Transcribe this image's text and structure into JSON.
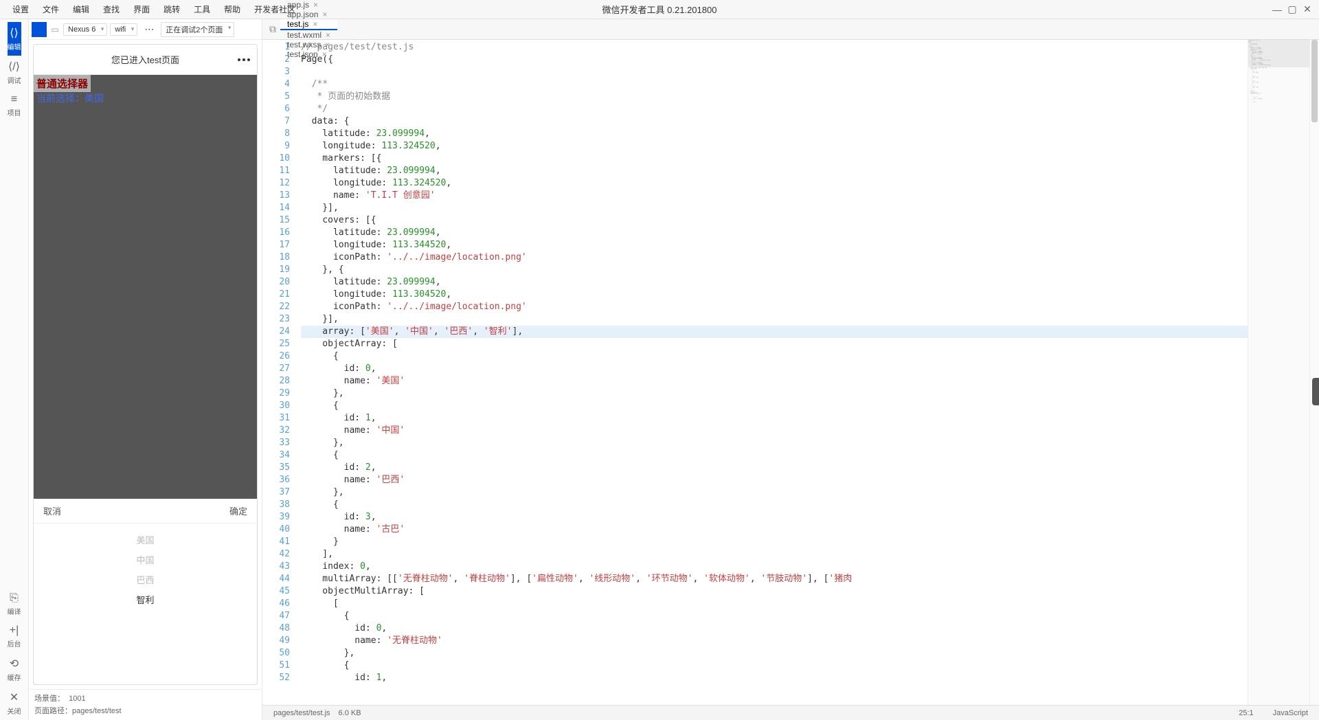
{
  "window": {
    "title": "微信开发者工具 0.21.201800"
  },
  "menubar": {
    "items": [
      "设置",
      "文件",
      "编辑",
      "查找",
      "界面",
      "跳转",
      "工具",
      "帮助",
      "开发者社区"
    ]
  },
  "leftSidebar": {
    "items": [
      {
        "icon": "⟨⟩",
        "label": "编辑",
        "active": true
      },
      {
        "icon": "⟨/⟩",
        "label": "调试"
      },
      {
        "icon": "≡",
        "label": "项目"
      }
    ],
    "bottom": [
      {
        "icon": "⎘",
        "label": "编译"
      },
      {
        "icon": "+|",
        "label": "后台"
      },
      {
        "icon": "⟲",
        "label": "缓存"
      },
      {
        "icon": "✕",
        "label": "关闭"
      }
    ]
  },
  "simulator": {
    "device": "Nexus 6",
    "network": "wifi",
    "previewStatus": "正在调试2个页面",
    "deviceTitle": "您已进入test页面",
    "pickerTitle": "普通选择器",
    "currentSelectLabel": "当前选择：",
    "currentSelectValue": "美国",
    "pickerCancel": "取消",
    "pickerConfirm": "确定",
    "pickerOptions": [
      "美国",
      "中国",
      "巴西",
      "智利"
    ],
    "pickerSelectedIndex": 3,
    "sceneLabel": "场景值：",
    "sceneValue": "1001",
    "pathLabel": "页面路径：",
    "pathValue": "pages/test/test"
  },
  "tabs": [
    {
      "name": "app.js",
      "active": false
    },
    {
      "name": "app.json",
      "active": false
    },
    {
      "name": "test.js",
      "active": true
    },
    {
      "name": "test.wxml",
      "active": false
    },
    {
      "name": "test.wxss",
      "active": false
    },
    {
      "name": "test.json",
      "active": false
    }
  ],
  "code": {
    "highlightLine": 24,
    "lines": [
      {
        "t": "comment",
        "s": "// pages/test/test.js"
      },
      {
        "t": "plain",
        "s": "Page({"
      },
      {
        "t": "plain",
        "s": ""
      },
      {
        "t": "comment",
        "s": "  /**"
      },
      {
        "t": "comment",
        "s": "   * 页面的初始数据"
      },
      {
        "t": "comment",
        "s": "   */"
      },
      {
        "t": "plain",
        "s": "  data: {"
      },
      {
        "t": "kv",
        "k": "    latitude: ",
        "v": "23.099994",
        "after": ","
      },
      {
        "t": "kv",
        "k": "    longitude: ",
        "v": "113.324520",
        "after": ","
      },
      {
        "t": "plain",
        "s": "    markers: [{"
      },
      {
        "t": "kv",
        "k": "      latitude: ",
        "v": "23.099994",
        "after": ","
      },
      {
        "t": "kv",
        "k": "      longitude: ",
        "v": "113.324520",
        "after": ","
      },
      {
        "t": "ks",
        "k": "      name: ",
        "v": "'T.I.T 创意园'"
      },
      {
        "t": "plain",
        "s": "    }],"
      },
      {
        "t": "plain",
        "s": "    covers: [{"
      },
      {
        "t": "kv",
        "k": "      latitude: ",
        "v": "23.099994",
        "after": ","
      },
      {
        "t": "kv",
        "k": "      longitude: ",
        "v": "113.344520",
        "after": ","
      },
      {
        "t": "ks",
        "k": "      iconPath: ",
        "v": "'../../image/location.png'"
      },
      {
        "t": "plain",
        "s": "    }, {"
      },
      {
        "t": "kv",
        "k": "      latitude: ",
        "v": "23.099994",
        "after": ","
      },
      {
        "t": "kv",
        "k": "      longitude: ",
        "v": "113.304520",
        "after": ","
      },
      {
        "t": "ks",
        "k": "      iconPath: ",
        "v": "'../../image/location.png'"
      },
      {
        "t": "plain",
        "s": "    }],"
      },
      {
        "t": "arr",
        "k": "    array: [",
        "v": [
          "'美国'",
          "'中国'",
          "'巴西'",
          "'智利'"
        ],
        "after": "],"
      },
      {
        "t": "plain",
        "s": "    objectArray: ["
      },
      {
        "t": "plain",
        "s": "      {"
      },
      {
        "t": "kv",
        "k": "        id: ",
        "v": "0",
        "after": ","
      },
      {
        "t": "ks",
        "k": "        name: ",
        "v": "'美国'"
      },
      {
        "t": "plain",
        "s": "      },"
      },
      {
        "t": "plain",
        "s": "      {"
      },
      {
        "t": "kv",
        "k": "        id: ",
        "v": "1",
        "after": ","
      },
      {
        "t": "ks",
        "k": "        name: ",
        "v": "'中国'"
      },
      {
        "t": "plain",
        "s": "      },"
      },
      {
        "t": "plain",
        "s": "      {"
      },
      {
        "t": "kv",
        "k": "        id: ",
        "v": "2",
        "after": ","
      },
      {
        "t": "ks",
        "k": "        name: ",
        "v": "'巴西'"
      },
      {
        "t": "plain",
        "s": "      },"
      },
      {
        "t": "plain",
        "s": "      {"
      },
      {
        "t": "kv",
        "k": "        id: ",
        "v": "3",
        "after": ","
      },
      {
        "t": "ks",
        "k": "        name: ",
        "v": "'古巴'"
      },
      {
        "t": "plain",
        "s": "      }"
      },
      {
        "t": "plain",
        "s": "    ],"
      },
      {
        "t": "kv",
        "k": "    index: ",
        "v": "0",
        "after": ","
      },
      {
        "t": "marr",
        "k": "    multiArray: [[",
        "groups": [
          [
            "'无脊柱动物'",
            "'脊柱动物'"
          ],
          [
            "'扁性动物'",
            "'线形动物'",
            "'环节动物'",
            "'软体动物'",
            "'节肢动物'"
          ],
          [
            "'猪肉"
          ]
        ],
        "after": ""
      },
      {
        "t": "plain",
        "s": "    objectMultiArray: ["
      },
      {
        "t": "plain",
        "s": "      ["
      },
      {
        "t": "plain",
        "s": "        {"
      },
      {
        "t": "kv",
        "k": "          id: ",
        "v": "0",
        "after": ","
      },
      {
        "t": "ks",
        "k": "          name: ",
        "v": "'无脊柱动物'"
      },
      {
        "t": "plain",
        "s": "        },"
      },
      {
        "t": "plain",
        "s": "        {"
      },
      {
        "t": "kv",
        "k": "          id: ",
        "v": "1",
        "after": ","
      }
    ]
  },
  "statusbar": {
    "path": "pages/test/test.js",
    "size": "6.0 KB",
    "lineCol": "25:1",
    "language": "JavaScript"
  }
}
